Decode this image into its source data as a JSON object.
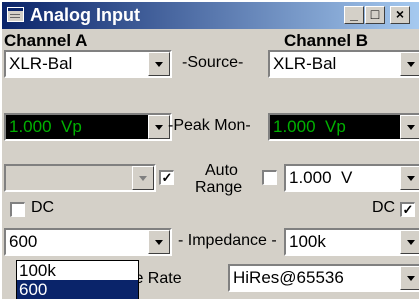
{
  "window": {
    "title": "Analog Input",
    "minimize": "_",
    "maximize": "□",
    "close": "×"
  },
  "channel_a": {
    "heading": "Channel A",
    "source": "XLR-Bal",
    "peak_mon": "1.000  Vp",
    "range_value": "",
    "auto_range_checked": true,
    "dc_checked": false,
    "dc_label": "DC",
    "impedance": "600"
  },
  "channel_b": {
    "heading": "Channel B",
    "source": "XLR-Bal",
    "peak_mon": "1.000  Vp",
    "range_value": "1.000  V",
    "auto_range_checked": false,
    "dc_checked": true,
    "dc_label": "DC",
    "impedance": "100k"
  },
  "labels": {
    "source": "-Source-",
    "peak_mon": "-Peak Mon-",
    "auto": "Auto",
    "range": "Range",
    "impedance": "- Impedance -",
    "sample_rate": "ple Rate"
  },
  "sample_rate": {
    "value": "HiRes@65536"
  },
  "impedance_dropdown": {
    "options": [
      "100k",
      "600"
    ],
    "selected": "600"
  },
  "colors": {
    "face": "#d4d0c8",
    "title_active": "#0a246a",
    "meter_bg": "#000000",
    "meter_text": "#00b000",
    "selection": "#0a246a"
  }
}
